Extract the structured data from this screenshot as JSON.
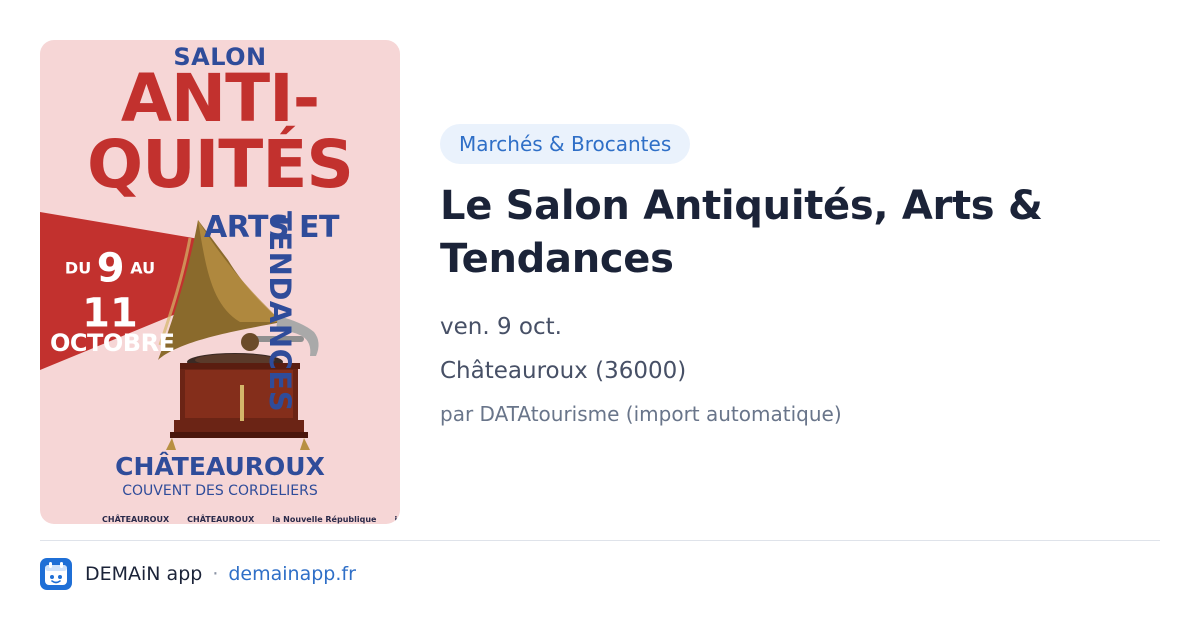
{
  "poster": {
    "salon": "SALON",
    "line1": "ANTI-",
    "line2": "QUITÉS",
    "arts": "ARTS ET",
    "tendances": "TENDANCES",
    "date_du": "DU",
    "date_start": "9",
    "date_au": "AU",
    "date_end": "11",
    "date_month": "OCTOBRE",
    "city": "CHÂTEAUROUX",
    "venue": "COUVENT DES CORDELIERS",
    "sponsors": [
      "CHÂTEAUROUX",
      "CHÂTEAUROUX",
      "la Nouvelle République",
      "ici"
    ],
    "colors": {
      "background": "#f6d6d6",
      "red": "#c2312e",
      "blue": "#2f4c9a"
    }
  },
  "event": {
    "category": "Marchés & Brocantes",
    "title": "Le Salon Antiquités, Arts & Tendances",
    "date": "ven. 9 oct.",
    "location": "Châteauroux (36000)",
    "source": "par DATAtourisme (import automatique)"
  },
  "footer": {
    "app_name": "DEMAiN app",
    "separator": "·",
    "domain": "demainapp.fr",
    "logo_icon": "demain-app-logo-icon",
    "accent": "#2f6fc7"
  }
}
